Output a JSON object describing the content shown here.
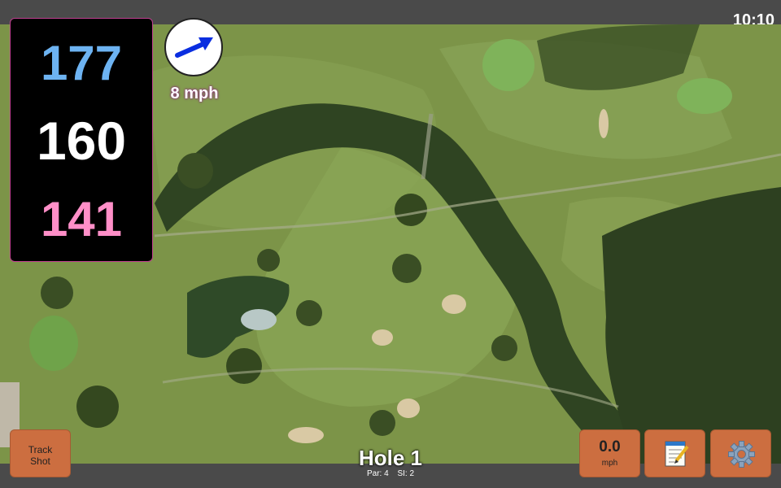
{
  "status_bar": {
    "time": "10:10"
  },
  "distances": {
    "back": "177",
    "middle": "160",
    "front": "141"
  },
  "wind": {
    "speed": "8 mph",
    "icon": "wind-arrow-icon"
  },
  "hole": {
    "title": "Hole 1",
    "par": "Par: 4",
    "stroke_index": "SI: 2"
  },
  "buttons": {
    "track_shot": {
      "line1": "Track",
      "line2": "Shot"
    },
    "speed": {
      "value": "0.0",
      "unit": "mph"
    },
    "notes_icon": "notepad-icon",
    "settings_icon": "gear-icon"
  },
  "colors": {
    "back_distance": "#6db3f2",
    "middle_distance": "#ffffff",
    "front_distance": "#ff8fc8",
    "button_bg": "#cc6e40",
    "bars": "#4a4a4a"
  }
}
